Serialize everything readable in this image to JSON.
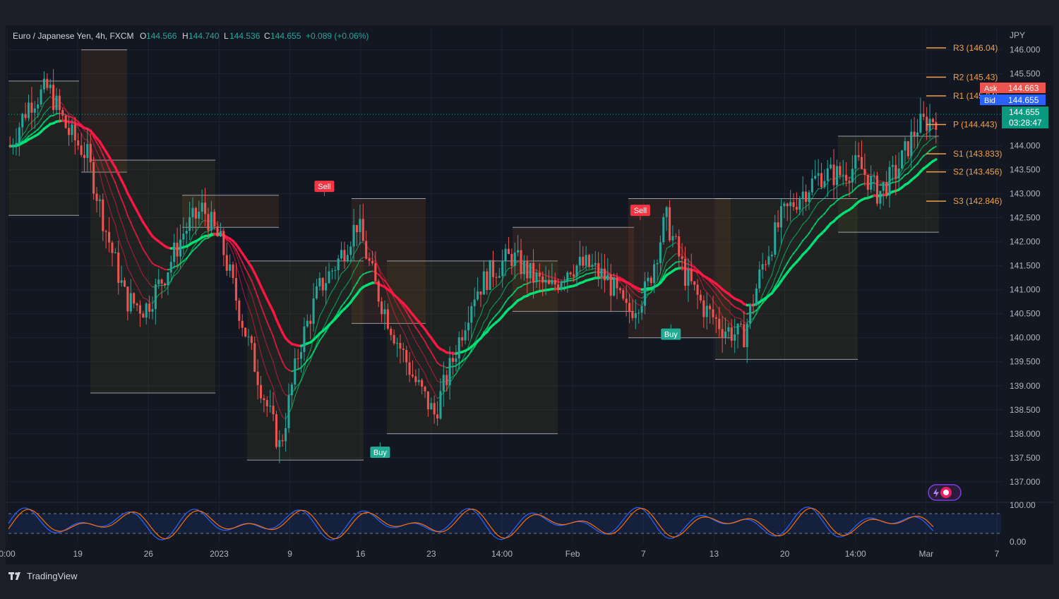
{
  "header": {
    "symbol": "Euro / Japanese Yen, 4h, FXCM",
    "o_label": "O",
    "o_value": "144.566",
    "h_label": "H",
    "h_value": "144.740",
    "l_label": "L",
    "l_value": "144.536",
    "c_label": "C",
    "c_value": "144.655",
    "change": "+0.089 (+0.06%)"
  },
  "currency": "JPY",
  "brand": "TradingView",
  "colors": {
    "background": "#131722",
    "bull": "#26a69a",
    "bear": "#ef5350",
    "pivot": "#f0a04b",
    "ask": "#ef5350",
    "bid": "#2962ff",
    "price_badge": "#089981",
    "band_green": "#00e676",
    "band_red": "#ff1744"
  },
  "price_badges": {
    "ask_label": "Ask",
    "ask_value": "144.663",
    "bid_label": "Bid",
    "bid_value": "144.655",
    "last_value": "144.655",
    "countdown": "03:28:47"
  },
  "pivots": [
    {
      "label": "R3 (146.04)",
      "value": 146.04
    },
    {
      "label": "R2 (145.43)",
      "value": 145.43
    },
    {
      "label": "R1 (145.04)",
      "value": 145.04
    },
    {
      "label": "P (144.443)",
      "value": 144.443
    },
    {
      "label": "S1 (143.833)",
      "value": 143.833
    },
    {
      "label": "S2 (143.456)",
      "value": 143.456
    },
    {
      "label": "S3 (142.846)",
      "value": 142.846
    }
  ],
  "signals": [
    {
      "label": "Sell",
      "type": "sell",
      "x_index": 0.34,
      "price": 142.95
    },
    {
      "label": "Sell",
      "type": "sell",
      "x_index": 0.68,
      "price": 142.45
    },
    {
      "label": "Buy",
      "type": "buy",
      "x_index": 0.4,
      "price": 137.82
    },
    {
      "label": "Buy",
      "type": "buy",
      "x_index": 0.713,
      "price": 140.28
    }
  ],
  "oscillator": {
    "levels": [
      "100.00",
      "0.00"
    ],
    "range": [
      0,
      100
    ]
  },
  "chart_data": {
    "type": "line",
    "title": "Euro / Japanese Yen, 4h, FXCM",
    "y_axis_ticks": [
      "146.000",
      "145.500",
      "145.000",
      "144.500",
      "144.000",
      "143.500",
      "143.000",
      "142.500",
      "142.000",
      "141.500",
      "141.000",
      "140.500",
      "140.000",
      "139.500",
      "139.000",
      "138.500",
      "138.000",
      "137.500",
      "137.000"
    ],
    "ylim": [
      136.6,
      146.45
    ],
    "x_axis_ticks": [
      "0:00",
      "19",
      "26",
      "2023",
      "9",
      "16",
      "23",
      "14:00",
      "Feb",
      "7",
      "13",
      "20",
      "14:00",
      "Mar",
      "7"
    ],
    "series": [
      {
        "values": [
          144.0,
          144.9,
          145.2,
          144.3,
          143.8,
          142.2,
          140.8,
          140.6,
          141.3,
          142.2,
          142.7,
          141.9,
          140.4,
          139.0,
          137.7,
          139.8,
          141.0,
          141.6,
          142.4,
          141.0,
          140.0,
          139.1,
          138.4,
          139.6,
          140.9,
          141.4,
          141.7,
          141.3,
          141.0,
          141.5,
          141.5,
          141.2,
          140.5,
          141.0,
          142.5,
          141.3,
          140.6,
          140.2,
          140.0,
          141.5,
          142.5,
          143.0,
          143.4,
          143.4,
          143.6,
          143.0,
          143.5,
          144.4,
          144.6
        ]
      }
    ]
  }
}
